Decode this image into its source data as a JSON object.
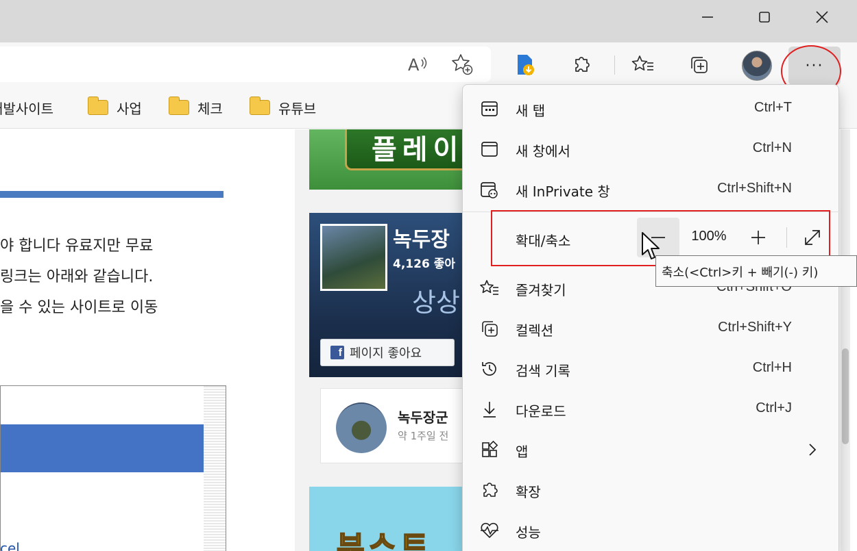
{
  "window_controls": {
    "minimize_glyph": "—",
    "maximize_glyph": "▢",
    "close_glyph": "✕"
  },
  "toolbar": {
    "read_aloud_icon": "read-aloud-icon",
    "add_favorite_icon": "add-favorite-icon",
    "more_label": "···"
  },
  "bookmarks": {
    "items": [
      {
        "label": "개발사이트"
      },
      {
        "label": "사업"
      },
      {
        "label": "체크"
      },
      {
        "label": "유튜브"
      }
    ]
  },
  "page": {
    "lines": [
      "야 합니다 유료지만 무료",
      "링크는 아래와 같습니다.",
      "을 수 있는 사이트로 이동"
    ],
    "link_fragment": "cel",
    "banner_text": "플레이",
    "fb": {
      "name": "녹두장",
      "likes": "4,126 좋아",
      "slogan": "상상",
      "like_button": "페이지 좋아요",
      "logo": "f"
    },
    "post": {
      "name": "녹두장군",
      "time": "약 1주일 전"
    },
    "cyan_text": "부스트"
  },
  "menu": {
    "items": [
      {
        "label": "새 탭",
        "shortcut": "Ctrl+T",
        "icon": "new-tab-icon"
      },
      {
        "label": "새 창에서",
        "shortcut": "Ctrl+N",
        "icon": "new-window-icon"
      },
      {
        "label": "새 InPrivate 창",
        "shortcut": "Ctrl+Shift+N",
        "icon": "inprivate-icon"
      }
    ],
    "zoom": {
      "label": "확대/축소",
      "value": "100%",
      "minus_label": "—",
      "plus_label": "+"
    },
    "items2": [
      {
        "label": "즐겨찾기",
        "shortcut": "Ctrl+Shift+O",
        "icon": "favorites-icon"
      },
      {
        "label": "컬렉션",
        "shortcut": "Ctrl+Shift+Y",
        "icon": "collections-icon"
      },
      {
        "label": "검색 기록",
        "shortcut": "Ctrl+H",
        "icon": "history-icon"
      },
      {
        "label": "다운로드",
        "shortcut": "Ctrl+J",
        "icon": "downloads-icon"
      },
      {
        "label": "앱",
        "shortcut": "",
        "icon": "apps-icon"
      },
      {
        "label": "확장",
        "shortcut": "",
        "icon": "extensions-icon"
      },
      {
        "label": "성능",
        "shortcut": "",
        "icon": "performance-icon"
      }
    ]
  },
  "tooltip": "축소(<Ctrl>키 + 빼기(-) 키)",
  "colors": {
    "highlight_red": "#e02020",
    "titlebar": "#d9d9d9",
    "menu_bg": "#f9f9f9"
  }
}
